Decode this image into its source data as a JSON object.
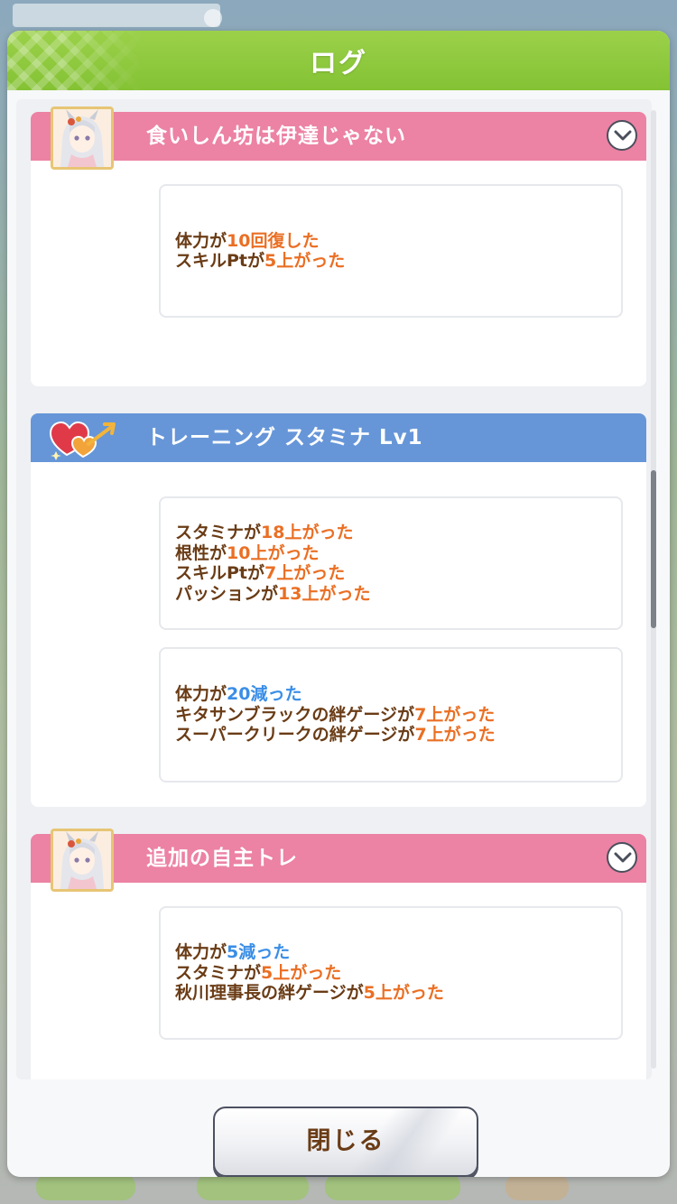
{
  "dialog": {
    "title": "ログ",
    "close_label": "閉じる"
  },
  "colors": {
    "header_green": "#8ac83a",
    "band_pink": "#ec82a4",
    "band_blue": "#6696d8",
    "text_brown": "#6a3c16",
    "increase_orange": "#ea6f24",
    "decrease_blue": "#3a8ee6"
  },
  "entries": [
    {
      "type": "character-event",
      "title": "食いしん坊は伊達じゃない",
      "avatar_icon": "character-portrait",
      "groups": [
        [
          {
            "subject": "体力が",
            "value": "10回復した",
            "direction": "up"
          },
          {
            "subject": "スキルPtが",
            "value": "5上がった",
            "direction": "up"
          }
        ]
      ]
    },
    {
      "type": "training",
      "title": "トレーニング スタミナ Lv1",
      "avatar_icon": "hearts-arrow-icon",
      "groups": [
        [
          {
            "subject": "スタミナが",
            "value": "18上がった",
            "direction": "up"
          },
          {
            "subject": "根性が",
            "value": "10上がった",
            "direction": "up"
          },
          {
            "subject": "スキルPtが",
            "value": "7上がった",
            "direction": "up"
          },
          {
            "subject": "パッションが",
            "value": "13上がった",
            "direction": "up"
          }
        ],
        [
          {
            "subject": "体力が",
            "value": "20減った",
            "direction": "down"
          },
          {
            "subject": "キタサンブラックの絆ゲージが",
            "value": "7上がった",
            "direction": "up"
          },
          {
            "subject": "スーパークリークの絆ゲージが",
            "value": "7上がった",
            "direction": "up"
          }
        ]
      ]
    },
    {
      "type": "character-event",
      "title": "追加の自主トレ",
      "avatar_icon": "character-portrait",
      "groups": [
        [
          {
            "subject": "体力が",
            "value": "5減った",
            "direction": "down"
          },
          {
            "subject": "スタミナが",
            "value": "5上がった",
            "direction": "up"
          },
          {
            "subject": "秋川理事長の絆ゲージが",
            "value": "5上がった",
            "direction": "up"
          }
        ]
      ]
    }
  ]
}
